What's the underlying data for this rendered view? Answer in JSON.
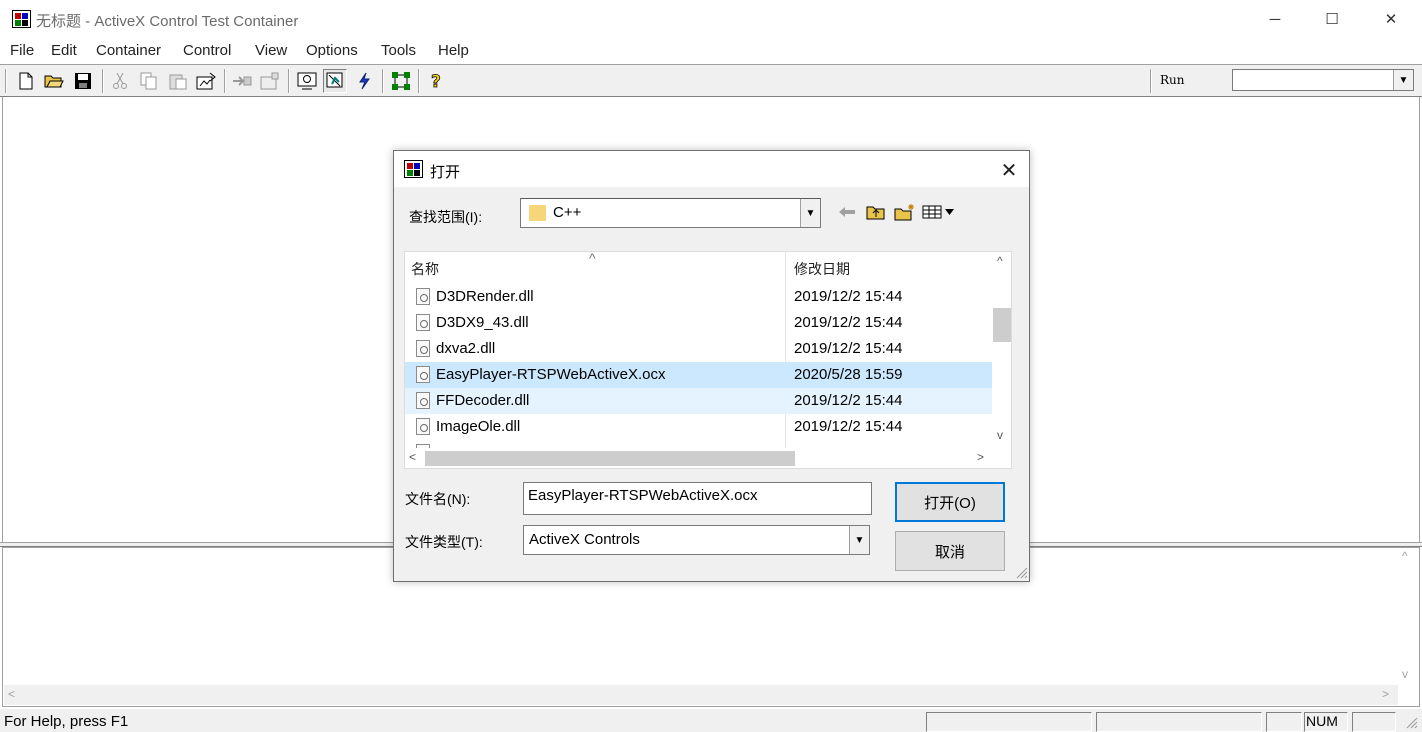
{
  "window": {
    "title": "无标题 - ActiveX Control Test Container",
    "minimize_glyph": "─",
    "maximize_glyph": "☐",
    "close_glyph": "✕"
  },
  "menu": [
    "File",
    "Edit",
    "Container",
    "Control",
    "View",
    "Options",
    "Tools",
    "Help"
  ],
  "toolbar": {
    "run_label": "Run",
    "run_value": "",
    "icons": [
      "new-icon",
      "open-icon",
      "save-icon",
      "cut-icon",
      "copy-icon",
      "paste-icon",
      "insert-control-icon",
      "invoke-methods-icon",
      "properties-icon",
      "design-mode-icon",
      "user-mode-icon",
      "events-icon",
      "control-logging-icon",
      "help-icon"
    ]
  },
  "status": {
    "help_text": "For Help, press F1",
    "num": "NUM"
  },
  "dialog": {
    "title": "打开",
    "look_in_label": "查找范围(I):",
    "look_in_value": "C++",
    "columns": {
      "name": "名称",
      "date": "修改日期"
    },
    "files": [
      {
        "name": "D3DRender.dll",
        "date": "2019/12/2 15:44",
        "state": "normal"
      },
      {
        "name": "D3DX9_43.dll",
        "date": "2019/12/2 15:44",
        "state": "normal"
      },
      {
        "name": "dxva2.dll",
        "date": "2019/12/2 15:44",
        "state": "normal"
      },
      {
        "name": "EasyPlayer-RTSPWebActiveX.ocx",
        "date": "2020/5/28 15:59",
        "state": "selected"
      },
      {
        "name": "FFDecoder.dll",
        "date": "2019/12/2 15:44",
        "state": "hover"
      },
      {
        "name": "ImageOle.dll",
        "date": "2019/12/2 15:44",
        "state": "normal"
      }
    ],
    "file_name_label": "文件名(N):",
    "file_name_value": "EasyPlayer-RTSPWebActiveX.ocx",
    "file_type_label": "文件类型(T):",
    "file_type_value": "ActiveX Controls",
    "open_button": "打开(O)",
    "cancel_button": "取消"
  }
}
